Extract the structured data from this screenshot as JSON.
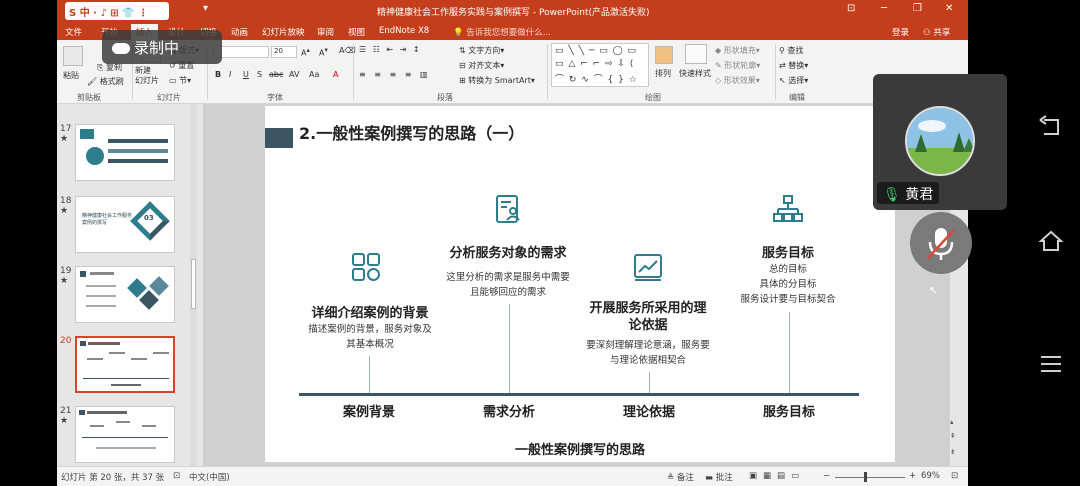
{
  "window": {
    "title": "精神健康社会工作服务实践与案例撰写 - PowerPoint(产品激活失败)",
    "login": "登录",
    "share": "共享"
  },
  "ime": {
    "label": "中 · ♪ ⊞ 👕 ⋮"
  },
  "recording": {
    "label": "录制中"
  },
  "tabs": [
    "文件",
    "开始",
    "插入",
    "设计",
    "切换",
    "动画",
    "幻灯片放映",
    "审阅",
    "视图",
    "EndNote X8"
  ],
  "tellme": "告诉我您想要做什么...",
  "ribbon": {
    "clipboard": {
      "paste": "粘贴",
      "copy": "复制",
      "format_painter": "格式刷",
      "label": "剪贴板"
    },
    "slides": {
      "new_slide": "新建\n幻灯片",
      "layout": "版式",
      "reset": "重置",
      "section": "节",
      "label": "幻灯片"
    },
    "font": {
      "size": "20",
      "label": "字体",
      "buttons": [
        "B",
        "I",
        "U",
        "S",
        "abc",
        "AV",
        "Aa",
        "A"
      ]
    },
    "paragraph": {
      "text_direction": "文字方向",
      "align_text": "对齐文本",
      "smartart": "转换为 SmartArt",
      "label": "段落"
    },
    "drawing": {
      "arrange": "排列",
      "quick_styles": "快速样式",
      "shape_fill": "形状填充",
      "shape_outline": "形状轮廓",
      "shape_effects": "形状效果",
      "label": "绘图"
    },
    "editing": {
      "find": "查找",
      "replace": "替换",
      "select": "选择",
      "label": "编辑"
    }
  },
  "thumbnails": [
    {
      "num": "17",
      "star": "★"
    },
    {
      "num": "18",
      "star": "★",
      "text": "精神健康社会工作服务案例的撰写",
      "badge": "03"
    },
    {
      "num": "19",
      "star": "★"
    },
    {
      "num": "20",
      "star": ""
    },
    {
      "num": "21",
      "star": "★"
    }
  ],
  "slide": {
    "title": "2.一般性案例撰写的思路（一）",
    "subtitle": "一般性案例撰写的思路",
    "columns": [
      {
        "title": "详细介绍案例的背景",
        "desc": "描述案例的背景，服务对象及\n其基本概况",
        "bottom": "案例背景",
        "icon": "grid-icon"
      },
      {
        "title": "分析服务对象的需求",
        "desc": "这里分析的需求是服务中需要\n且能够回应的需求",
        "bottom": "需求分析",
        "icon": "document-user-icon"
      },
      {
        "title": "开展服务所采用的理\n论依据",
        "desc": "要深刻理解理论意涵，服务要\n与理论依据相契合",
        "bottom": "理论依据",
        "icon": "chart-trend-icon"
      },
      {
        "title": "服务目标",
        "desc": "总的目标\n具体的分目标\n服务设计要与目标契合",
        "bottom": "服务目标",
        "icon": "org-chart-icon"
      }
    ]
  },
  "statusbar": {
    "slide_info": "幻灯片 第 20 张，共 37 张",
    "language": "中文(中国)",
    "notes": "备注",
    "comments": "批注",
    "zoom": "69%"
  },
  "video": {
    "name": "黄君"
  },
  "colors": {
    "ppt_red": "#c43e1c",
    "slide_accent": "#3b5563",
    "icon_teal": "#2e7d8c"
  }
}
